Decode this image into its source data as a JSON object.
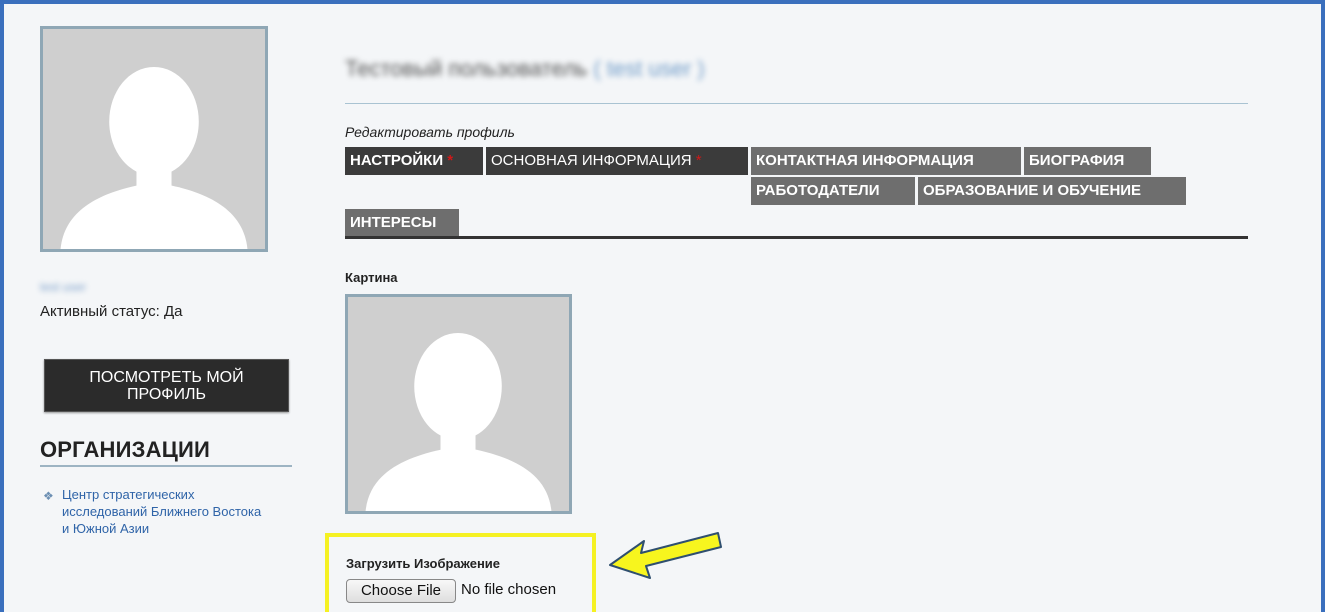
{
  "sidebar": {
    "username": "test user",
    "active_status": "Активный статус: Да",
    "view_profile_button": "ПОСМОТРЕТЬ МОЙ ПРОФИЛЬ",
    "organizations_heading": "ОРГАНИЗАЦИИ",
    "organizations": [
      "Центр стратегических исследований Ближнего Востока и Южной Азии"
    ]
  },
  "header": {
    "name": "Тестовый пользователь",
    "username_paren": "( test user )"
  },
  "edit_profile_label": "Редактировать профиль",
  "tabs": [
    {
      "label": "НАСТРОЙКИ",
      "required": "*"
    },
    {
      "label": "ОСНОВНАЯ ИНФОРМАЦИЯ",
      "required": "*"
    },
    {
      "label": "КОНТАКТНАЯ ИНФОРМАЦИЯ"
    },
    {
      "label": "БИОГРАФИЯ"
    },
    {
      "label": "РАБОТОДАТЕЛИ"
    },
    {
      "label": "ОБРАЗОВАНИЕ И ОБУЧЕНИЕ"
    },
    {
      "label": "ИНТЕРЕСЫ"
    }
  ],
  "picture_label": "Картина",
  "upload": {
    "label": "Загрузить Изображение",
    "button": "Choose File",
    "status": "No file chosen"
  },
  "colors": {
    "frame": "#3a6fbd",
    "highlight": "#f5f123",
    "tab_bg": "#6e6e6e",
    "tab_active_bg": "#3b3b3b",
    "required_mark": "#d01818",
    "link": "#2f64a8"
  },
  "icons": {
    "organization_bullet": "diamond-dots-icon",
    "annotation_arrow": "yellow-arrow-icon"
  }
}
